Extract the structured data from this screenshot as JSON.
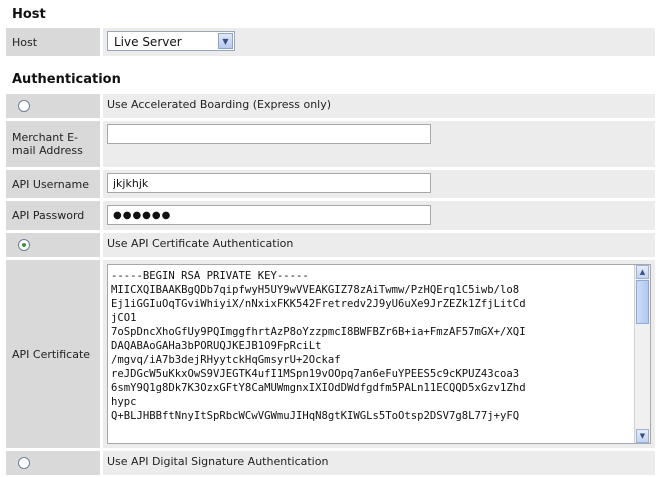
{
  "host": {
    "section_title": "Host",
    "label": "Host",
    "selected": "Live Server"
  },
  "auth": {
    "section_title": "Authentication",
    "accelerated_label": "Use Accelerated Boarding (Express only)",
    "merchant_email_label": "Merchant E-mail Address",
    "merchant_email_value": "",
    "api_username_label": "API Username",
    "api_username_value": "jkjkhjk",
    "api_password_label": "API Password",
    "api_password_value": "●●●●●●",
    "cert_auth_label": "Use API Certificate Authentication",
    "api_cert_label": "API Certificate",
    "api_cert_lines": [
      "-----BEGIN RSA PRIVATE KEY-----",
      "MIICXQIBAAKBgQDb7qipfwyH5UY9wVVEAKGIZ78zAiTwmw/PzHQErq1C5iwb/lo8",
      "Ej1iGGIuOqTGviWhiyiX/nNxixFKK542Fretredv2J9yU6uXe9JrZEZk1ZfjLitCd",
      "jCO1",
      "7oSpDncXhoGfUy9PQImggfhrtAzP8oYzzpmcI8BWFBZr6B+ia+FmzAF57mGX+/XQI",
      "DAQABAoGAHa3bPORUQJKEJB1O9FpRciLt",
      "/mgvq/iA7b3dejRHyytckHqGmsyrU+2Ockaf",
      "reJDGcW5uKkxOwS9VJEGTK4ufI1MSpn19vOOpq7an6eFuYPEES5c9cKPUZ43coa3",
      "6smY9Q1g8Dk7K3OzxGFtY8CaMUWmgnxIXIOdDWdfgdfm5PALn11ECQQD5xGzv1Zhd",
      "hypc",
      "Q+BLJHBBftNnyItSpRbcWCwVGWmuJIHqN8gtKIWGLs5ToOtsp2DSV7g8L77j+yFQ"
    ],
    "sig_auth_label": "Use API Digital Signature Authentication"
  },
  "colors": {
    "label_bg": "#d9d9d9",
    "value_bg": "#ececec",
    "radio_checked": "#3a9a3a"
  }
}
